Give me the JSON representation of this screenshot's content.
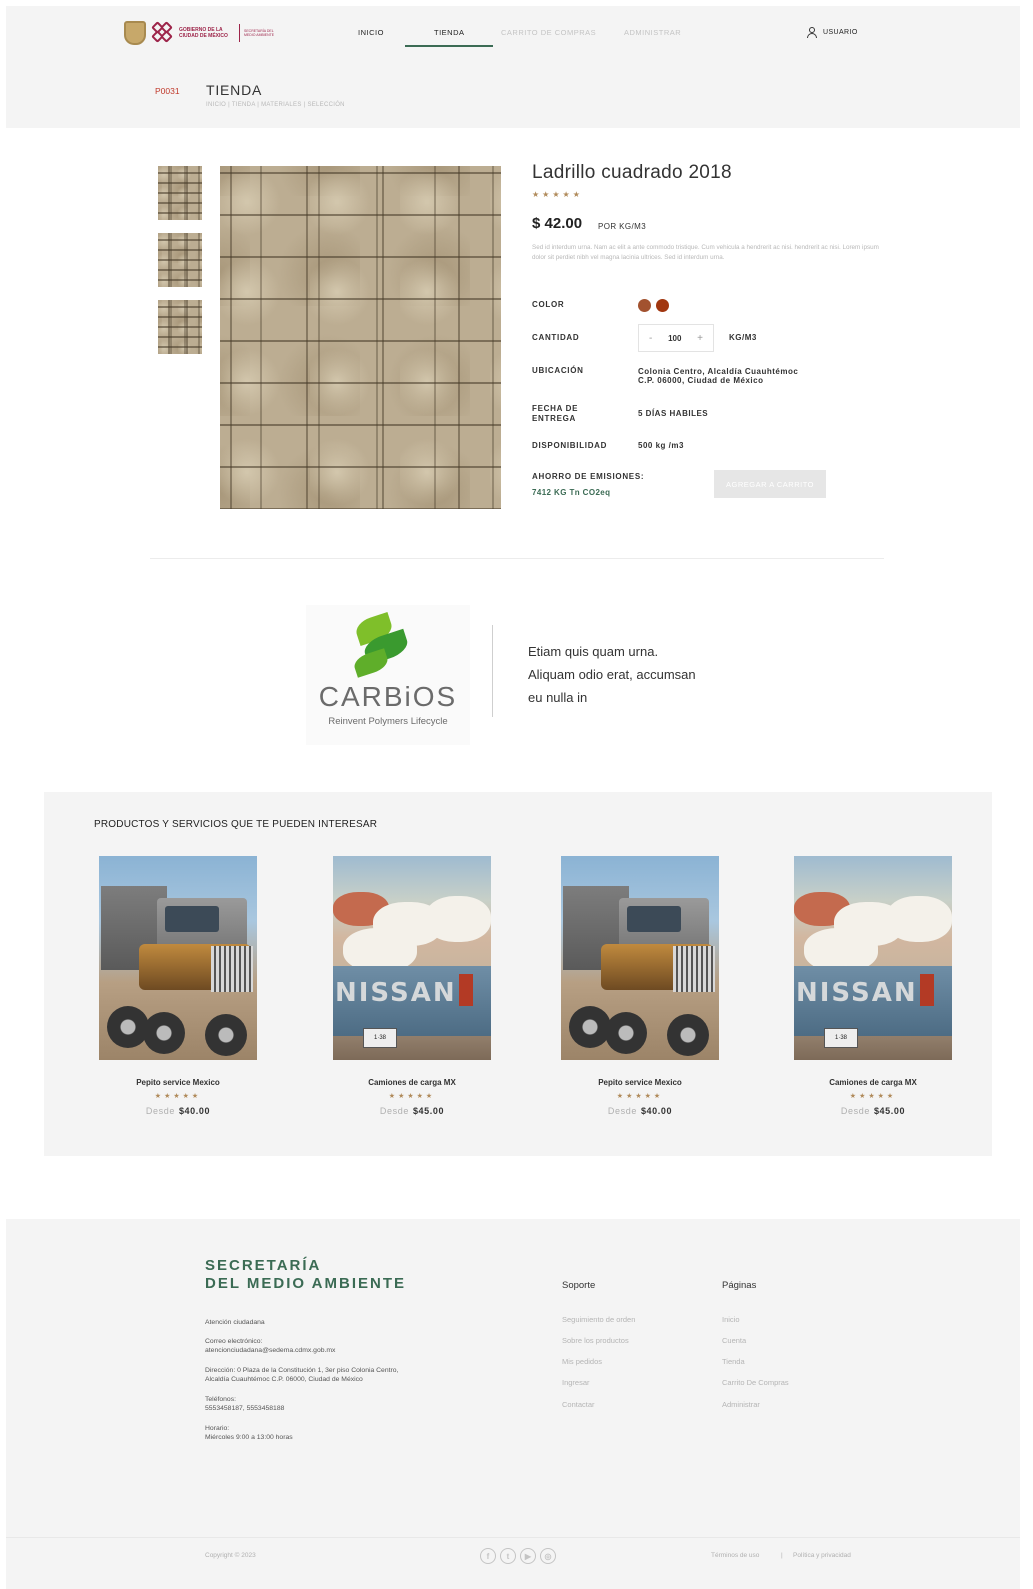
{
  "header": {
    "logo_text": "GOBIERNO DE LA CIUDAD DE MÉXICO",
    "logo_sub": "SECRETARÍA DEL MEDIO AMBIENTE",
    "nav": [
      "INICIO",
      "TIENDA",
      "CARRITO DE COMPRAS",
      "ADMINISTRAR"
    ],
    "active_nav": "TIENDA",
    "user_label": "USUARIO",
    "page_code": "P0031",
    "page_title": "TIENDA",
    "breadcrumb": "INICIO  |  TIENDA  |  MATERIALES  |  SELECCIÓN"
  },
  "product": {
    "title": "Ladrillo cuadrado 2018",
    "rating_stars": "★★★★★",
    "price": "$ 42.00",
    "price_unit": "POR KG/M3",
    "description": "Sed id interdum urna. Nam ac elit a ante commodo tristique. Cum vehicula a hendrerit ac nisi. hendrerit ac nisi. Lorem ipsum dolor sit perdiet nibh vel magna lacinia ultrices. Sed id interdum urna.",
    "labels": {
      "color": "COLOR",
      "quantity": "CANTIDAD",
      "location": "UBICACIÓN",
      "delivery": "FECHA DE ENTREGA",
      "availability": "DISPONIBILIDAD",
      "savings": "AHORRO DE EMISIONES:"
    },
    "colors": [
      "#a2522f",
      "#a1360f"
    ],
    "quantity": {
      "minus": "-",
      "value": "100",
      "plus": "+",
      "unit": "KG/M3"
    },
    "location_line1": "Colonia Centro, Alcaldía Cuauhtémoc",
    "location_line2": "C.P. 06000, Ciudad de México",
    "delivery": "5 DÍAS HABILES",
    "availability": "500 kg /m3",
    "savings_value": "7412 KG Tn CO2eq",
    "add_to_cart": "AGREGAR A CARRITO"
  },
  "partner": {
    "name": "CARBiOS",
    "tagline": "Reinvent Polymers Lifecycle",
    "quote_lines": [
      "Etiam quis quam urna.",
      "Aliquam odio erat, accumsan",
      "eu nulla in"
    ]
  },
  "related": {
    "title": "PRODUCTOS Y SERVICIOS QUE TE PUEDEN INTERESAR",
    "items": [
      {
        "name": "Pepito service Mexico",
        "stars": "★★★★★",
        "from": "Desde",
        "price": "$40.00",
        "image": "dump-truck",
        "brand": "",
        "plate": ""
      },
      {
        "name": "Camiones de carga MX",
        "stars": "★★★★★",
        "from": "Desde",
        "price": "$45.00",
        "image": "pickup-truck",
        "brand": "NISSAN",
        "plate": "1·38"
      },
      {
        "name": "Pepito service Mexico",
        "stars": "★★★★★",
        "from": "Desde",
        "price": "$40.00",
        "image": "dump-truck",
        "brand": "",
        "plate": ""
      },
      {
        "name": "Camiones de carga MX",
        "stars": "★★★★★",
        "from": "Desde",
        "price": "$45.00",
        "image": "pickup-truck",
        "brand": "NISSAN",
        "plate": "1·38"
      }
    ]
  },
  "footer": {
    "brand_line1": "SECRETARÍA",
    "brand_line2": "DEL MEDIO AMBIENTE",
    "attention": "Atención ciudadana",
    "email_label": "Correo electrónico:",
    "email": "atencionciudadana@sedema.cdmx.gob.mx",
    "address_line1": "Dirección: 0 Plaza de la Constitución 1, 3er piso Colonia Centro,",
    "address_line2": "Alcaldía Cuauhtémoc C.P. 06000, Ciudad de México",
    "phones_label": "Teléfonos:",
    "phones": "5553458187, 5553458188",
    "hours_label": "Horario:",
    "hours": "Miércoles 9:00 a 13:00 horas",
    "support_title": "Soporte",
    "support_links": [
      "Seguimiento de orden",
      "Sobre los productos",
      "Mis pedidos",
      "Ingresar",
      "Contactar"
    ],
    "pages_title": "Páginas",
    "pages_links": [
      "Inicio",
      "Cuenta",
      "Tienda",
      "Carrito De Compras",
      "Administrar"
    ],
    "copyright": "Copyright © 2023",
    "social": [
      "facebook-icon",
      "twitter-icon",
      "youtube-icon",
      "instagram-icon"
    ],
    "terms": "Términos de uso",
    "legal_sep": "|",
    "privacy": "Política y privacidad"
  }
}
